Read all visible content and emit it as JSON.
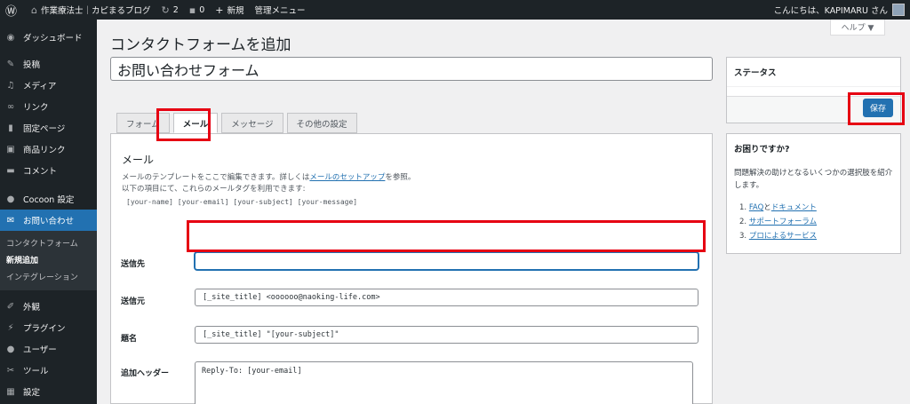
{
  "admin_bar": {
    "site_name": "作業療法士｜カピまるブログ",
    "updates_count": "2",
    "comments_count": "0",
    "new_label": "新規",
    "admin_menu_label": "管理メニュー",
    "greeting": "こんにちは、KAPIMARU さん"
  },
  "sidebar": {
    "items": [
      {
        "label": "ダッシュボード",
        "icon": "dashboard-icon"
      },
      {
        "label": "投稿",
        "icon": "pin-icon"
      },
      {
        "label": "メディア",
        "icon": "media-icon"
      },
      {
        "label": "リンク",
        "icon": "link-icon"
      },
      {
        "label": "固定ページ",
        "icon": "page-icon"
      },
      {
        "label": "商品リンク",
        "icon": "product-link-icon"
      },
      {
        "label": "コメント",
        "icon": "comment-icon"
      },
      {
        "label": "Cocoon 設定",
        "icon": "cocoon-icon"
      },
      {
        "label": "お問い合わせ",
        "icon": "mail-icon"
      },
      {
        "label": "外観",
        "icon": "appearance-icon"
      },
      {
        "label": "プラグイン",
        "icon": "plugin-icon"
      },
      {
        "label": "ユーザー",
        "icon": "user-icon"
      },
      {
        "label": "ツール",
        "icon": "tool-icon"
      },
      {
        "label": "設定",
        "icon": "settings-icon"
      }
    ],
    "submenu": [
      "コンタクトフォーム",
      "新規追加",
      "インテグレーション"
    ]
  },
  "main": {
    "help_label": "ヘルプ ▼",
    "page_title": "コンタクトフォームを追加",
    "form_title_value": "お問い合わせフォーム",
    "tabs": [
      {
        "label": "フォーム"
      },
      {
        "label": "メール"
      },
      {
        "label": "メッセージ"
      },
      {
        "label": "その他の設定"
      }
    ],
    "mail": {
      "heading": "メール",
      "desc_part1": "メールのテンプレートをここで編集できます。詳しくは",
      "desc_link": "メールのセットアップ",
      "desc_part2": "を参照。",
      "desc_line2": "以下の項目にて、これらのメールタグを利用できます:",
      "tags": "[your-name] [your-email] [your-subject] [your-message]",
      "fields": {
        "to_label": "送信先",
        "to_value": "",
        "from_label": "送信元",
        "from_value": "[_site_title] <oooooo@naoking-life.com>",
        "subject_label": "題名",
        "subject_value": "[_site_title] \"[your-subject]\"",
        "headers_label": "追加ヘッダー",
        "headers_value": "Reply-To: [your-email]"
      }
    }
  },
  "status_box": {
    "title": "ステータス",
    "save_label": "保存"
  },
  "help_box": {
    "title": "お困りですか?",
    "text": "問題解決の助けとなるいくつかの選択肢を紹介します。",
    "links": [
      {
        "num": "1.",
        "a": "FAQ",
        "mid": "と",
        "b": "ドキュメント"
      },
      {
        "num": "2.",
        "a": "サポートフォーラム"
      },
      {
        "num": "3.",
        "a": "プロによるサービス"
      }
    ]
  },
  "colors": {
    "accent": "#2271b1",
    "admin_bar": "#1d2327",
    "highlight": "#e60012"
  }
}
